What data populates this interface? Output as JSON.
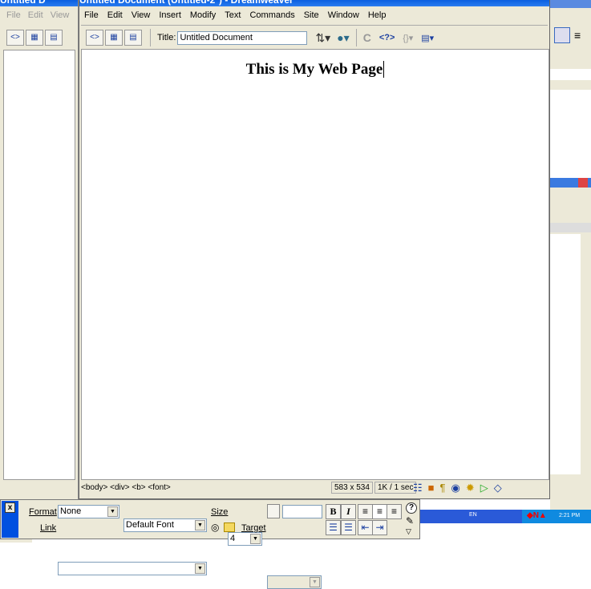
{
  "back_window": {
    "title": "Untitled D",
    "menu": [
      "File",
      "Edit",
      "View"
    ]
  },
  "main_window": {
    "title": "Untitled Document (Untitled-2*) - Dreamweaver",
    "menu": [
      "File",
      "Edit",
      "View",
      "Insert",
      "Modify",
      "Text",
      "Commands",
      "Site",
      "Window",
      "Help"
    ],
    "toolbar": {
      "title_label": "Title:",
      "title_value": "Untitled Document"
    },
    "document": {
      "heading": "This is My Web Page"
    },
    "status": {
      "tag_selector": "<body> <div> <b> <font>",
      "window_size": "583 x 534",
      "download": "1K / 1 sec"
    }
  },
  "properties": {
    "close": "x",
    "format_label": "Format",
    "format_value": "None",
    "font_value": "Default Font",
    "size_label": "Size",
    "size_value": "4",
    "link_label": "Link",
    "link_value": "",
    "target_label": "Target",
    "bold": "B",
    "italic": "I",
    "help": "?"
  },
  "taskbar": {
    "lang": "EN",
    "clock": "2:21 PM"
  }
}
